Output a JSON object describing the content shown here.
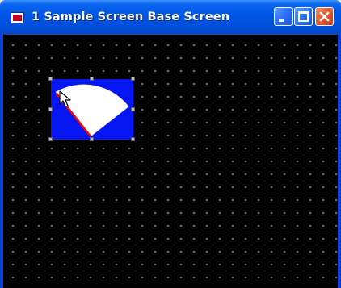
{
  "window": {
    "title": "1 Sample Screen Base Screen",
    "icon": "screen-editor-app-icon",
    "controls": [
      "minimize-icon",
      "maximize-icon",
      "close-icon"
    ]
  },
  "editor": {
    "background_color": "#000000",
    "grid_color": "#2fb4a8",
    "grid_visible": true
  },
  "selected_part": {
    "type": "meter",
    "fill_color": "#0616f2",
    "dial_color": "#ffffff",
    "needle_color": "#ff0000",
    "handles": 8
  }
}
